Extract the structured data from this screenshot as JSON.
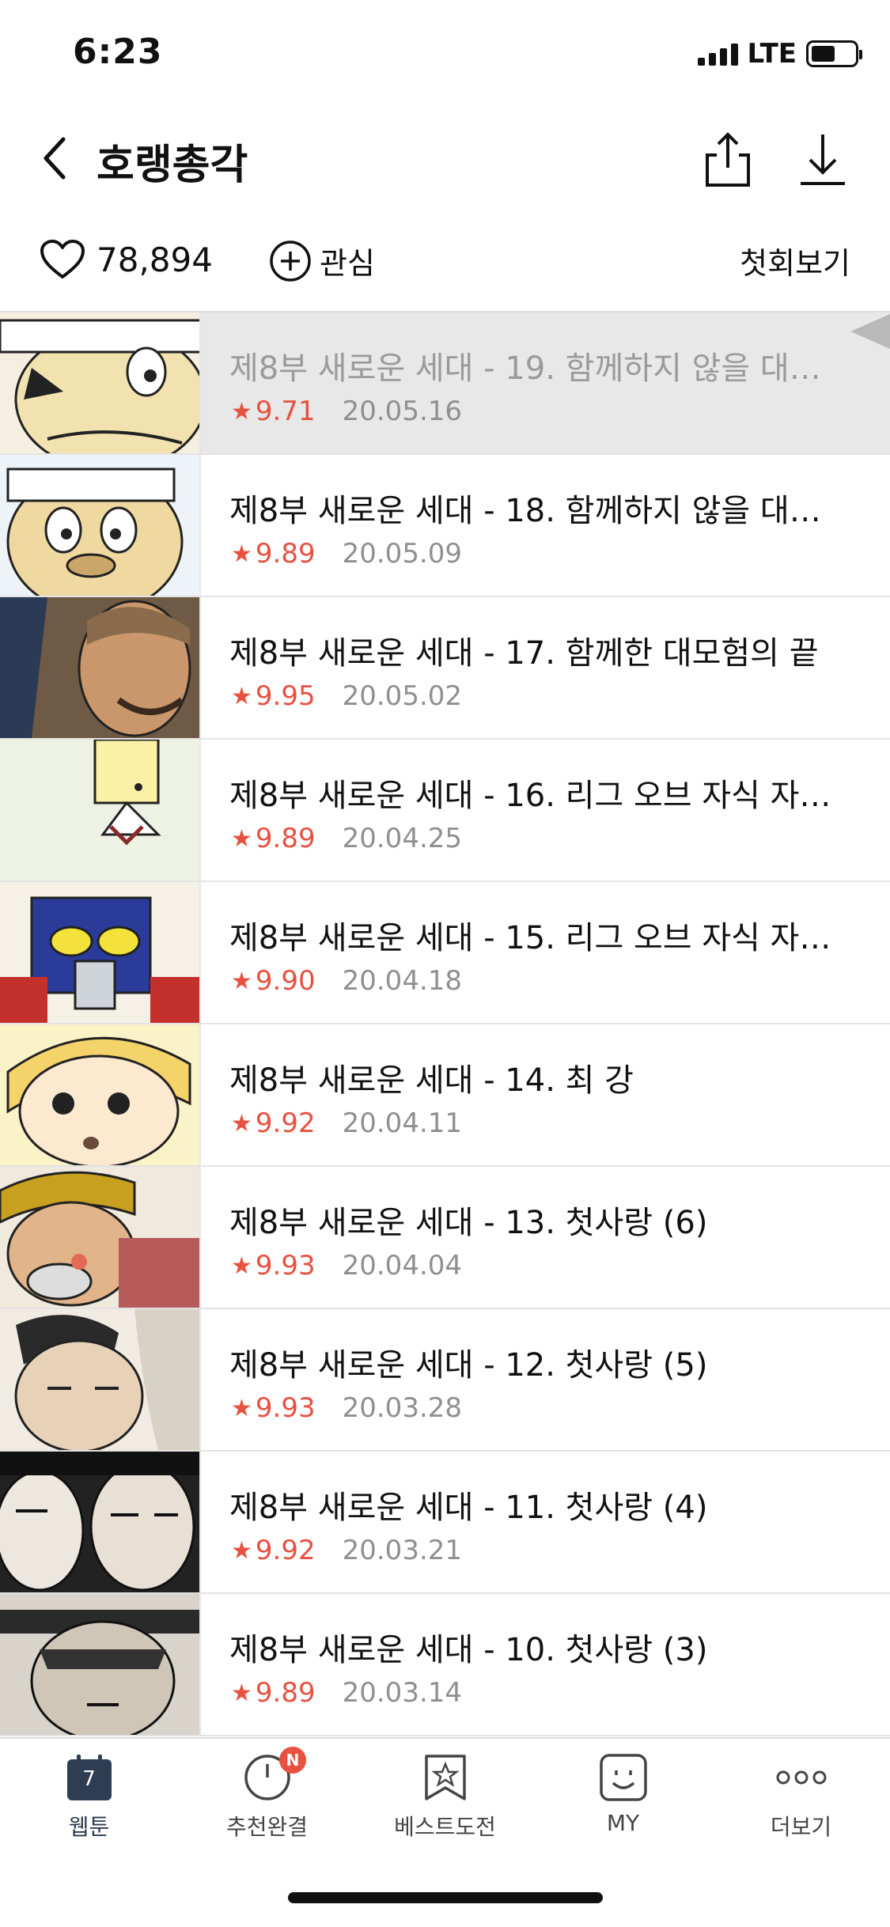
{
  "status": {
    "time": "6:23",
    "network": "LTE"
  },
  "nav": {
    "title": "호랭총각"
  },
  "actions": {
    "like_count": "78,894",
    "favorite_label": "관심",
    "first_episode_label": "첫회보기"
  },
  "episodes": [
    {
      "title": "제8부 새로운 세대 - 19. 함께하지 않을 대모…",
      "rating": "9.71",
      "date": "20.05.16"
    },
    {
      "title": "제8부 새로운 세대 - 18. 함께하지 않을 대모…",
      "rating": "9.89",
      "date": "20.05.09"
    },
    {
      "title": "제8부 새로운 세대 - 17. 함께한 대모험의 끝",
      "rating": "9.95",
      "date": "20.05.02"
    },
    {
      "title": "제8부 새로운 세대 - 16. 리그 오브 자식 자…",
      "rating": "9.89",
      "date": "20.04.25"
    },
    {
      "title": "제8부 새로운 세대 - 15. 리그 오브 자식 자…",
      "rating": "9.90",
      "date": "20.04.18"
    },
    {
      "title": "제8부 새로운 세대 - 14. 최 강",
      "rating": "9.92",
      "date": "20.04.11"
    },
    {
      "title": "제8부 새로운 세대 - 13. 첫사랑 (6)",
      "rating": "9.93",
      "date": "20.04.04"
    },
    {
      "title": "제8부 새로운 세대 - 12. 첫사랑 (5)",
      "rating": "9.93",
      "date": "20.03.28"
    },
    {
      "title": "제8부 새로운 세대 - 11. 첫사랑 (4)",
      "rating": "9.92",
      "date": "20.03.21"
    },
    {
      "title": "제8부 새로운 세대 - 10. 첫사랑 (3)",
      "rating": "9.89",
      "date": "20.03.14"
    }
  ],
  "tabs": [
    {
      "label": "웹툰",
      "icon": "calendar-icon",
      "icon_text": "7"
    },
    {
      "label": "추천완결",
      "icon": "clock-icon",
      "badge": "N"
    },
    {
      "label": "베스트도전",
      "icon": "bookmark-star-icon"
    },
    {
      "label": "MY",
      "icon": "smile-icon"
    },
    {
      "label": "더보기",
      "icon": "more-dots-icon"
    }
  ],
  "colors": {
    "accent": "#e8503f",
    "read_row": "#e8e8e8",
    "tab_active": "#2b3a4e"
  }
}
